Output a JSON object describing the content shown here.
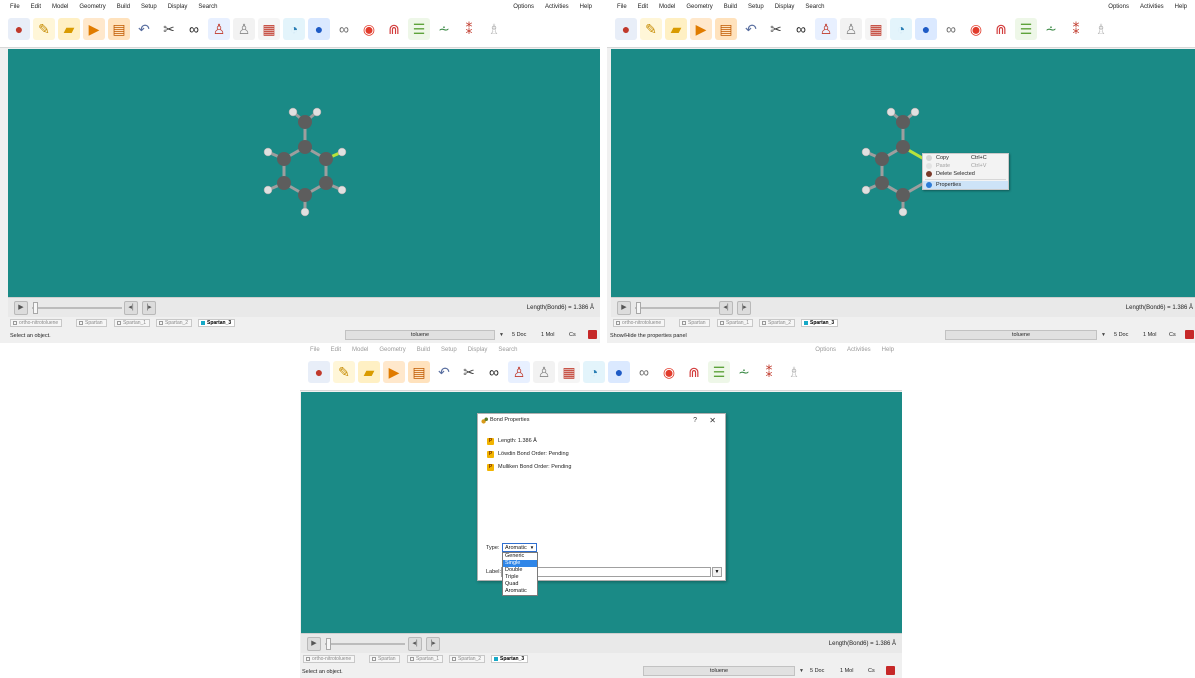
{
  "menu": {
    "left": [
      "File",
      "Edit",
      "Model",
      "Geometry",
      "Build",
      "Setup",
      "Display",
      "Search"
    ],
    "right": [
      "Options",
      "Activities",
      "Help"
    ]
  },
  "toolbar_icons": [
    "new-document-icon",
    "edit-icon",
    "open-folder-icon",
    "import-icon",
    "save-icon",
    "undo-icon",
    "cut-icon",
    "view-glasses-icon",
    "builder-icon",
    "molecule-builder-icon",
    "spreadsheet-icon",
    "calculation-icon",
    "info-sphere-icon",
    "orbital-icon",
    "surface-icon",
    "spectra-icon",
    "table-icon",
    "reaction-icon",
    "dipole-icon",
    "microscope-icon"
  ],
  "status": {
    "readout": "Length(Bond6) = 1.386 Å",
    "molecule_name": "toluene",
    "doc_count": "5 Doc",
    "mol_count": "1 Mol",
    "symmetry": "Cs"
  },
  "tabs": [
    "ortho-nitrotoluene",
    "Spartan",
    "Spartan_1",
    "Spartan_2",
    "Spartan_3"
  ],
  "panels": [
    {
      "status_text": "Select an object."
    },
    {
      "status_text": "Show/Hide the properties panel"
    },
    {
      "status_text": "Select an object."
    }
  ],
  "context_menu": {
    "items": [
      {
        "label": "Copy",
        "shortcut": "Ctrl+C",
        "enabled": true
      },
      {
        "label": "Paste",
        "shortcut": "Ctrl+V",
        "enabled": false
      },
      {
        "label": "Delete Selected",
        "shortcut": "",
        "enabled": true
      },
      {
        "label": "Properties",
        "shortcut": "",
        "enabled": true,
        "highlighted": true
      }
    ]
  },
  "bond_dialog": {
    "title": "Bond Properties",
    "help": "?",
    "close": "✕",
    "properties": [
      "Length: 1.386 Å",
      "Löwdin Bond Order: Pending",
      "Mulliken Bond Order: Pending"
    ],
    "type_label": "Type:",
    "type_value": "Aromatic",
    "label_label": "Label:",
    "label_value": "",
    "type_options": [
      "Generic",
      "Single",
      "Double",
      "Triple",
      "Quad",
      "Aromatic"
    ],
    "type_options_highlighted": "Single"
  },
  "colors": {
    "viewport": "#1a8a86",
    "carbon": "#5d5d5d",
    "hydrogen": "#e0e0e0",
    "selected_bond": "#b7e33a"
  }
}
